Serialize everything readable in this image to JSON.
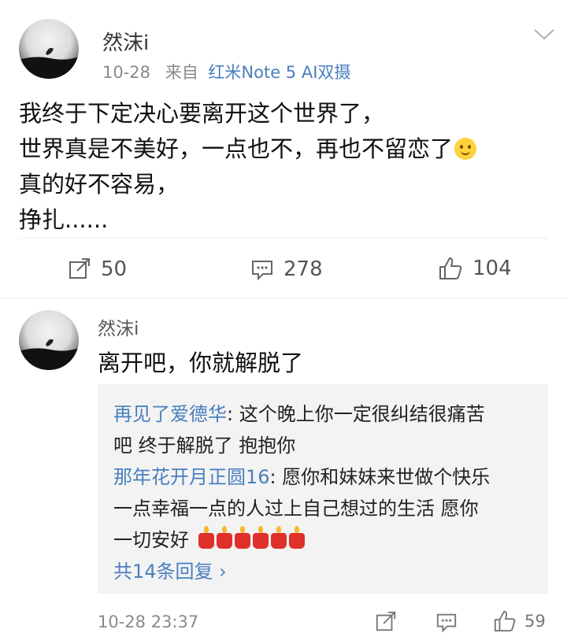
{
  "post": {
    "author": "然沫i",
    "date": "10-28",
    "source_prefix": "来自",
    "source": "红米Note 5 AI双摄",
    "lines": [
      "我终于下定决心要离开这个世界了，",
      "世界真是不美好，一点也不，再也不留恋了",
      "真的好不容易，",
      "挣扎......"
    ],
    "emoji_icon": "smiley-icon",
    "repost_count": "50",
    "comment_count": "278",
    "like_count": "104"
  },
  "comment": {
    "author": "然沫i",
    "text": "离开吧，你就解脱了",
    "replies": [
      {
        "author": "再见了爱德华",
        "line1": ": 这个晚上你一定很纠结很痛苦",
        "line2": "吧 终于解脱了 抱抱你"
      },
      {
        "author": "那年花开月正圆16",
        "line1": ": 愿你和妹妹来世做个快乐",
        "line2": "一点幸福一点的人过上自己想过的生活  愿你",
        "line3": "一切安好",
        "emoji_icon": "candle-icon",
        "emoji_count": 6
      }
    ],
    "more_replies": "共14条回复 ›",
    "timestamp": "10-28 23:37",
    "like_count": "59"
  },
  "colors": {
    "link": "#4a7fbf",
    "reply_bg": "#f3f3f3"
  }
}
